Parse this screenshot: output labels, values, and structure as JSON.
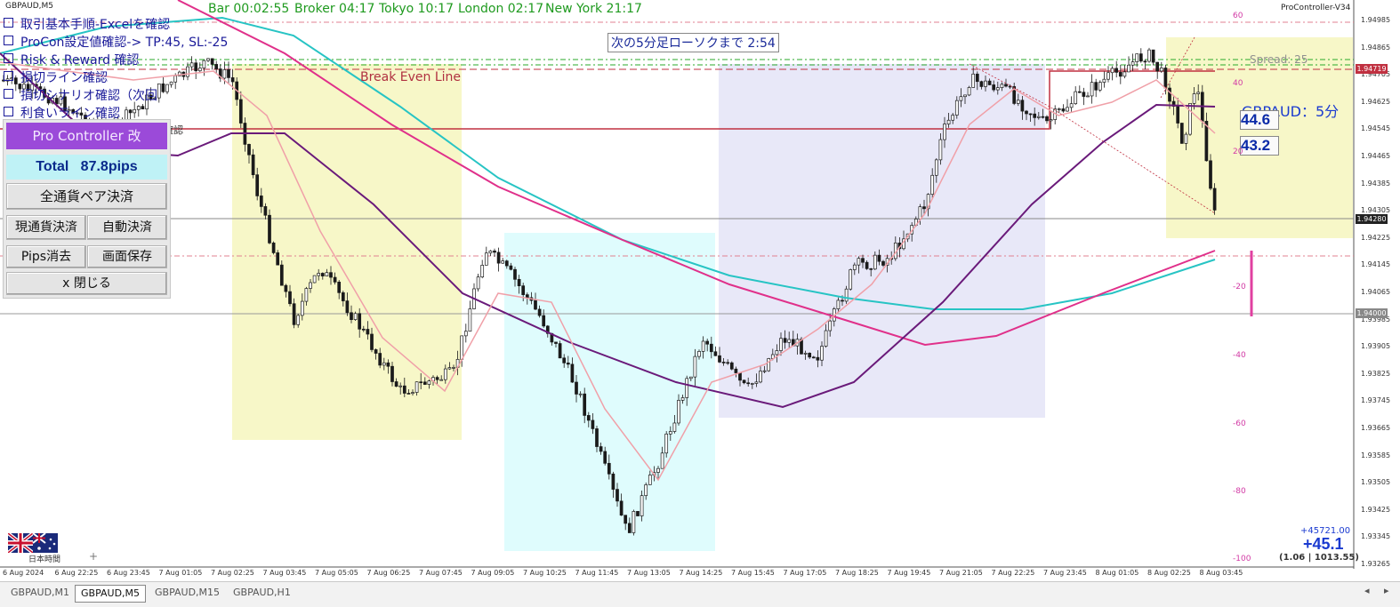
{
  "window": {
    "symbol_line": "GBPAUD,M5",
    "indicator_name": "ProController-V34"
  },
  "sessions": {
    "bar": "Bar 00:02:55",
    "broker": "Broker 04:17",
    "tokyo": "Tokyo 10:17",
    "london": "London 02:17",
    "newyork": "New York 21:17"
  },
  "checklist": [
    "取引基本手順-Excelを確認",
    "ProCon設定値確認-> TP:45, SL:-25",
    "Risk & Reward 確認",
    "損切ライン確認",
    "損切シナリオ確認（次回",
    "利食いライン確認",
    "確認"
  ],
  "candle_timer": "次の5分足ローソクまで 2:54",
  "break_even_label": "Break Even Line",
  "spread_label": "Spread: 25",
  "pair_label": "GBPAUD：5分",
  "value_boxes": [
    "44.6",
    "43.2"
  ],
  "panel": {
    "title": "Pro Controller 改",
    "total_label": "Total",
    "total_value": "87.8pips",
    "all_close": "全通貨ペア決済",
    "current_close": "現通貨決済",
    "auto_close": "自動決済",
    "pips_clear": "Pips消去",
    "screen_save": "画面保存",
    "close": "x 閉じる"
  },
  "bottom_right": {
    "line1": "+45721.00",
    "line2": "+45.1",
    "line3": "(1.06 | 1013.55)"
  },
  "jp_time": "日本時間",
  "price_axis": [
    "1.94985",
    "1.94865",
    "1.94705",
    "1.94625",
    "1.94545",
    "1.94465",
    "1.94385",
    "1.94305",
    "1.94225",
    "1.94145",
    "1.94065",
    "1.93985",
    "1.93905",
    "1.93825",
    "1.93745",
    "1.93665",
    "1.93585",
    "1.93505",
    "1.93425",
    "1.93345",
    "1.93265"
  ],
  "price_tags": {
    "upper": "1.94719",
    "current": "1.94280",
    "lower": "1.94000"
  },
  "rsi_axis": [
    "60",
    "40",
    "20",
    "20",
    "40",
    "60",
    "80",
    "100"
  ],
  "time_axis": [
    "6 Aug 2024",
    "6 Aug 22:25",
    "6 Aug 23:45",
    "7 Aug 01:05",
    "7 Aug 02:25",
    "7 Aug 03:45",
    "7 Aug 05:05",
    "7 Aug 06:25",
    "7 Aug 07:45",
    "7 Aug 09:05",
    "7 Aug 10:25",
    "7 Aug 11:45",
    "7 Aug 13:05",
    "7 Aug 14:25",
    "7 Aug 15:45",
    "7 Aug 17:05",
    "7 Aug 18:25",
    "7 Aug 19:45",
    "7 Aug 21:05",
    "7 Aug 22:25",
    "7 Aug 23:45",
    "8 Aug 01:05",
    "8 Aug 02:25",
    "8 Aug 03:45"
  ],
  "tabs": [
    "GBPAUD,M1",
    "GBPAUD,M5",
    "GBPAUD,M15",
    "GBPAUD,H1"
  ],
  "colors": {
    "tokyo_zone": "#f7f7c8",
    "london_zone": "#dffcfd",
    "ny_zone": "#e8e8f8",
    "ma_cyan": "#27c4c4",
    "ma_pink": "#e0308a",
    "ma_purple": "#6a1a7a",
    "ma_light": "#f0a0a8",
    "resistance": "#c03040",
    "candle": "#1a1a1a"
  },
  "chart_data": {
    "type": "candlestick",
    "price_range": [
      1.9326,
      1.9499
    ],
    "current_price": 1.9428,
    "levels": {
      "upper": 1.94719,
      "break_even": 1.94545,
      "lower": 1.94
    }
  }
}
